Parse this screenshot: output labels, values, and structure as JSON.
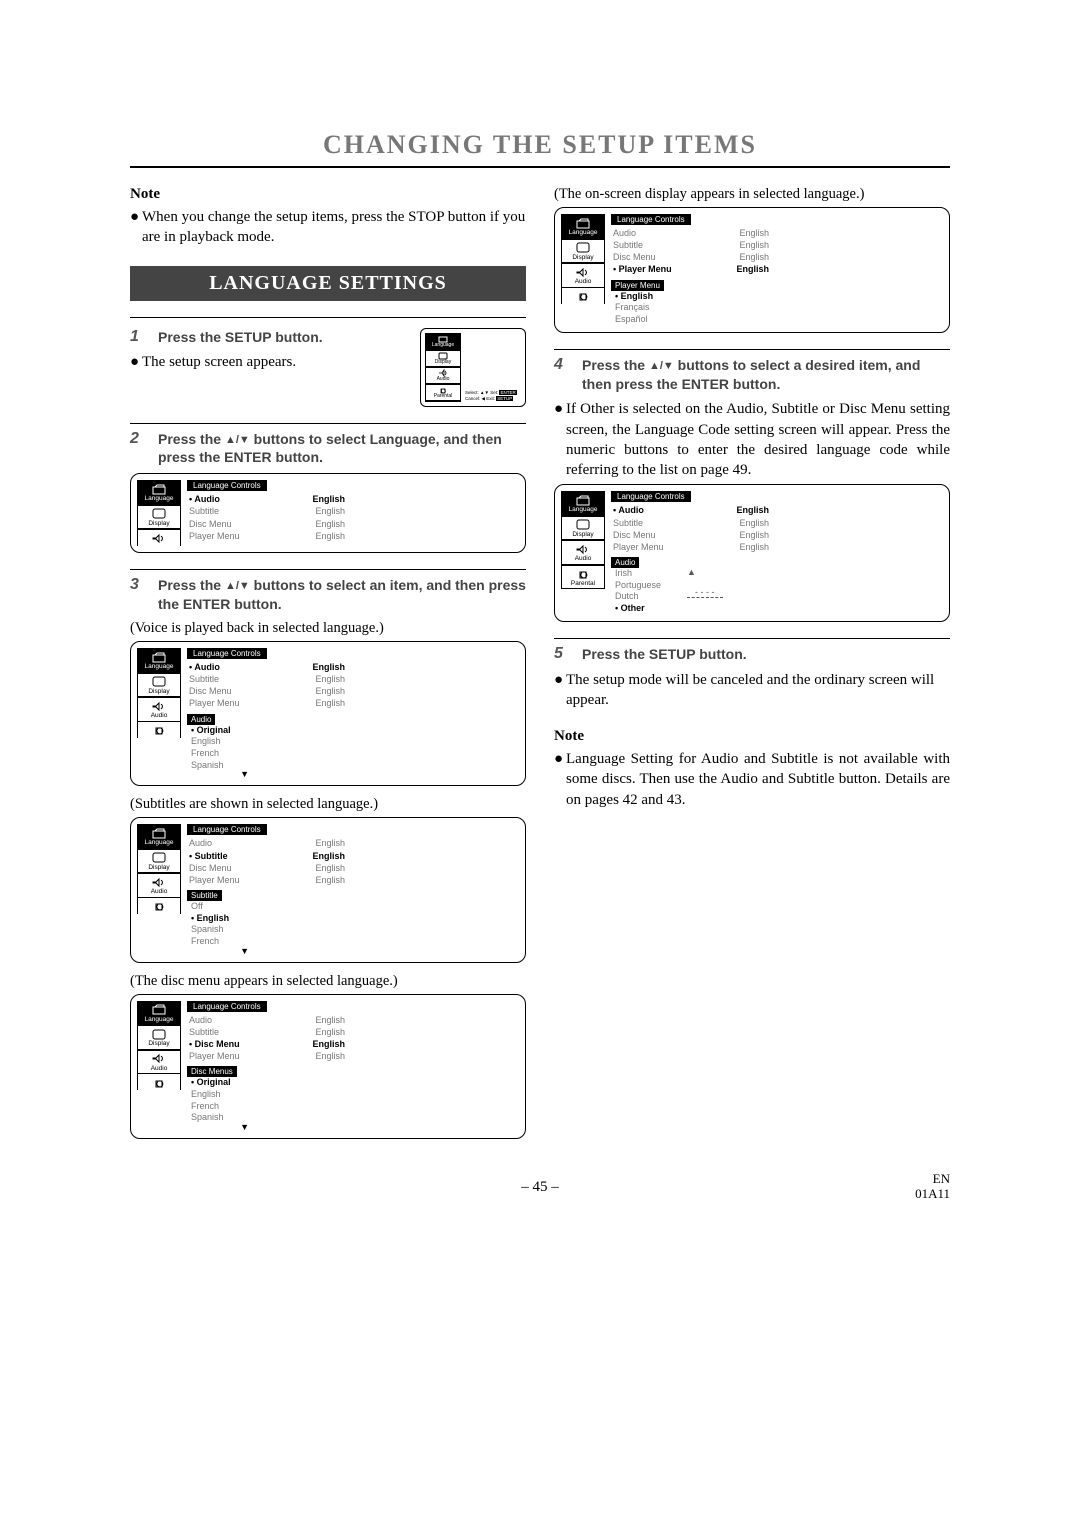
{
  "title": "CHANGING THE SETUP ITEMS",
  "noteHead": "Note",
  "introBullet": "When you change the setup items, press the STOP button if you are in playback mode.",
  "banner": "LANGUAGE SETTINGS",
  "step1": {
    "num": "1",
    "text": "Press the SETUP button."
  },
  "appears": "The setup screen appears.",
  "miniSetup": {
    "nav": [
      "Language",
      "Display",
      "Audio",
      "Parental"
    ],
    "line1a": "Select:",
    "line1b": "Set:",
    "line1c": "ENTER",
    "line2a": "Cancel:",
    "line2b": "Exit:",
    "line2c": "SETUP"
  },
  "step2": {
    "num": "2",
    "preText": "Press the ",
    "postText": " buttons to select Language, and then press the ENTER button."
  },
  "osdTitle": "Language Controls",
  "osdNav": {
    "language": "Language",
    "display": "Display",
    "audio": "Audio",
    "parental": "Parental"
  },
  "osdItems": [
    "Audio",
    "Subtitle",
    "Disc Menu",
    "Player Menu"
  ],
  "english": "English",
  "step3": {
    "num": "3",
    "preText": "Press the ",
    "postText": " buttons to select an item, and then press the ENTER button."
  },
  "capVoice": "(Voice is played back in selected language.)",
  "audioOpts": {
    "title": "Audio",
    "items": [
      "Original",
      "English",
      "French",
      "Spanish"
    ]
  },
  "capSubtitle": "(Subtitles are shown in selected language.)",
  "subtitleOpts": {
    "title": "Subtitle",
    "items": [
      "Off",
      "English",
      "Spanish",
      "French"
    ]
  },
  "capDiscMenu": "(The disc menu appears in selected language.)",
  "discMenuOpts": {
    "title": "Disc Menus",
    "items": [
      "Original",
      "English",
      "French",
      "Spanish"
    ]
  },
  "capOnScreen": "(The on-screen display appears in selected language.)",
  "playerMenuOpts": {
    "title": "Player Menu",
    "items": [
      "English",
      "Français",
      "Español"
    ]
  },
  "step4": {
    "num": "4",
    "preText": "Press the ",
    "postText": " buttons to select a desired item, and then press the ENTER button."
  },
  "paraOther": "If Other is selected on the Audio, Subtitle or Disc Menu setting screen, the Language Code setting screen will appear. Press the numeric buttons to enter the desired language code while referring to the list on page 49.",
  "otherOpts": {
    "title": "Audio",
    "items": [
      "Irish",
      "Portuguese",
      "Dutch",
      "Other"
    ],
    "ellip": "- - - -"
  },
  "step5": {
    "num": "5",
    "text": "Press the SETUP button."
  },
  "paraCancel": "The setup mode will be canceled and the ordinary screen will appear.",
  "noteBullet": "Language Setting for Audio and Subtitle is not available with some discs. Then use the Audio and Subtitle button. Details are on pages 42 and 43.",
  "pageNum": "– 45 –",
  "footerR1": "EN",
  "footerR2": "01A11"
}
